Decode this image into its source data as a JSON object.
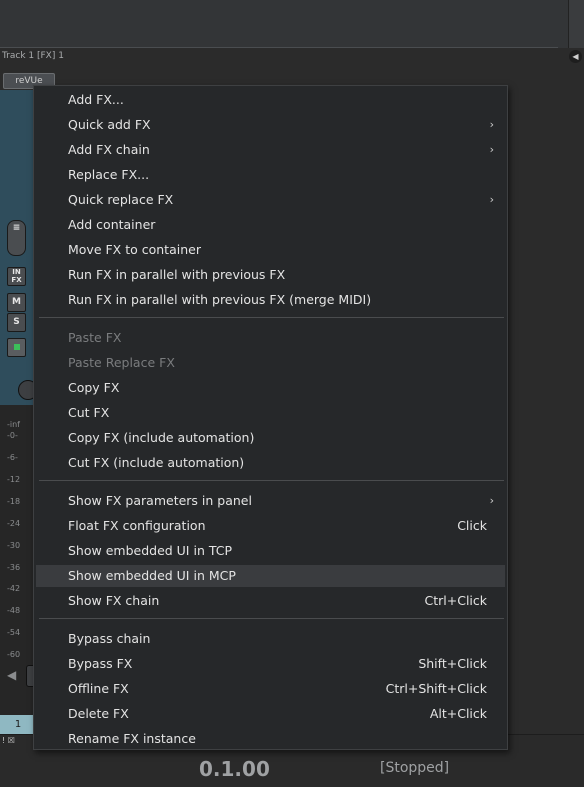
{
  "window": {
    "track_title": "Track 1 [FX] 1",
    "fx_button_label": "reVUe",
    "track_number": "1"
  },
  "mcp": {
    "buttons": {
      "env": "≡",
      "input_fx": "IN FX",
      "mute": "M",
      "solo": "S"
    },
    "input_label": "-inf",
    "db_scale": [
      "-0-",
      "-6-",
      "-12",
      "-18",
      "-24",
      "-30",
      "-36",
      "-42",
      "-48",
      "-54",
      "-60"
    ]
  },
  "transport": {
    "time": "0.1.00",
    "status": "[Stopped]"
  },
  "menu": {
    "items": [
      {
        "label": "Add FX...",
        "shortcut": "",
        "submenu": false,
        "disabled": false
      },
      {
        "label": "Quick add FX",
        "shortcut": "",
        "submenu": true,
        "disabled": false
      },
      {
        "label": "Add FX chain",
        "shortcut": "",
        "submenu": true,
        "disabled": false
      },
      {
        "label": "Replace FX...",
        "shortcut": "",
        "submenu": false,
        "disabled": false
      },
      {
        "label": "Quick replace FX",
        "shortcut": "",
        "submenu": true,
        "disabled": false
      },
      {
        "label": "Add container",
        "shortcut": "",
        "submenu": false,
        "disabled": false
      },
      {
        "label": "Move FX to container",
        "shortcut": "",
        "submenu": false,
        "disabled": false
      },
      {
        "label": "Run FX in parallel with previous FX",
        "shortcut": "",
        "submenu": false,
        "disabled": false
      },
      {
        "label": "Run FX in parallel with previous FX (merge MIDI)",
        "shortcut": "",
        "submenu": false,
        "disabled": false
      },
      {
        "label": "Paste FX",
        "shortcut": "",
        "submenu": false,
        "disabled": true
      },
      {
        "label": "Paste Replace FX",
        "shortcut": "",
        "submenu": false,
        "disabled": true
      },
      {
        "label": "Copy FX",
        "shortcut": "",
        "submenu": false,
        "disabled": false
      },
      {
        "label": "Cut FX",
        "shortcut": "",
        "submenu": false,
        "disabled": false
      },
      {
        "label": "Copy FX (include automation)",
        "shortcut": "",
        "submenu": false,
        "disabled": false
      },
      {
        "label": "Cut FX (include automation)",
        "shortcut": "",
        "submenu": false,
        "disabled": false
      },
      {
        "label": "Show FX parameters in panel",
        "shortcut": "",
        "submenu": true,
        "disabled": false
      },
      {
        "label": "Float FX configuration",
        "shortcut": "Click",
        "submenu": false,
        "disabled": false
      },
      {
        "label": "Show embedded UI in TCP",
        "shortcut": "",
        "submenu": false,
        "disabled": false
      },
      {
        "label": "Show embedded UI in MCP",
        "shortcut": "",
        "submenu": false,
        "disabled": false,
        "highlighted": true
      },
      {
        "label": "Show FX chain",
        "shortcut": "Ctrl+Click",
        "submenu": false,
        "disabled": false
      },
      {
        "label": "Bypass chain",
        "shortcut": "",
        "submenu": false,
        "disabled": false
      },
      {
        "label": "Bypass FX",
        "shortcut": "Shift+Click",
        "submenu": false,
        "disabled": false
      },
      {
        "label": "Offline FX",
        "shortcut": "Ctrl+Shift+Click",
        "submenu": false,
        "disabled": false
      },
      {
        "label": "Delete FX",
        "shortcut": "Alt+Click",
        "submenu": false,
        "disabled": false
      },
      {
        "label": "Rename FX instance",
        "shortcut": "",
        "submenu": false,
        "disabled": false
      }
    ],
    "submenu_arrow": "›"
  },
  "colors": {
    "menu_bg": "#26282a",
    "menu_text": "#e4e4e4",
    "disabled_text": "#7a7c7e",
    "highlight_bg": "#3a3c3f",
    "track_color": "#8fb8c2",
    "mcp_panel": "#2f4d5c"
  }
}
